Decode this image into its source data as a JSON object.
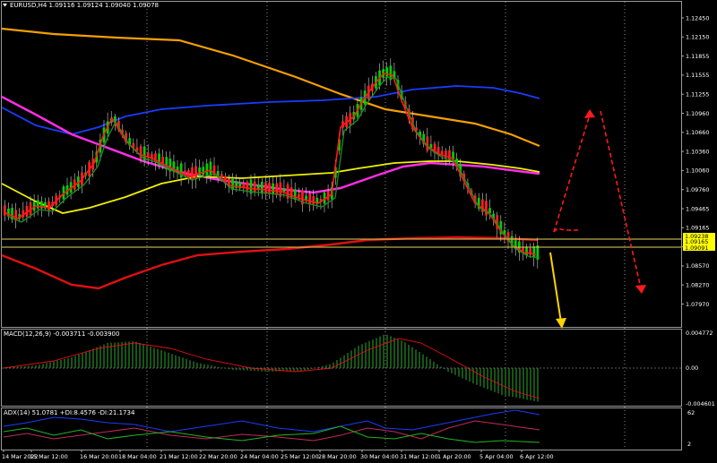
{
  "main": {
    "symbol_line": "EURUSD,H4  1.09116 1.09124 1.09040 1.09078",
    "price_labels": [
      "1.12450",
      "1.12150",
      "1.11855",
      "1.11555",
      "1.11255",
      "1.10960",
      "1.10660",
      "1.10360",
      "1.10060",
      "1.09760",
      "1.09465",
      "1.09165",
      "1.08865",
      "1.08570",
      "1.08270",
      "1.07970"
    ],
    "marked_levels": [
      {
        "text": "1.09238",
        "color": "#ffff00"
      },
      {
        "text": "1.09165",
        "color": "#ffff00"
      },
      {
        "text": "1.09091",
        "color": "#ffff00"
      }
    ]
  },
  "macd": {
    "label": "MACD(12,26,9) -0.003711 -0.003900",
    "scale_labels": [
      "0.004772",
      "0.00",
      "-0.004601"
    ]
  },
  "adx": {
    "label": "ADX(14) 51.0781 +DI:8.4576 -DI:21.1734",
    "scale_labels": [
      "62",
      "2"
    ]
  },
  "time_labels": [
    "14 Mar 2022",
    "15 Mar 12:00",
    "16 Mar 20:00",
    "18 Mar 04:00",
    "21 Mar 12:00",
    "22 Mar 20:00",
    "24 Mar 04:00",
    "25 Mar 12:00",
    "28 Mar 20:00",
    "30 Mar 04:00",
    "31 Mar 12:00",
    "1 Apr 20:00",
    "5 Apr 04:00",
    "6 Apr 12:00"
  ],
  "colors": {
    "background": "#000000",
    "bull_candle": "#00d000",
    "bear_candle": "#ff2020",
    "ma_orange": "#f5a000",
    "ma_blue": "#1a3cff",
    "ma_magenta": "#ff2de6",
    "ma_yellow": "#f0f000",
    "ma_red": "#e01010",
    "fast_red": "#ff1a1a",
    "fast_green": "#1f8f1f",
    "grid": "#8a8a8a",
    "annotation_red": "#ff1a1a",
    "annotation_yellow": "#ffd400"
  }
}
